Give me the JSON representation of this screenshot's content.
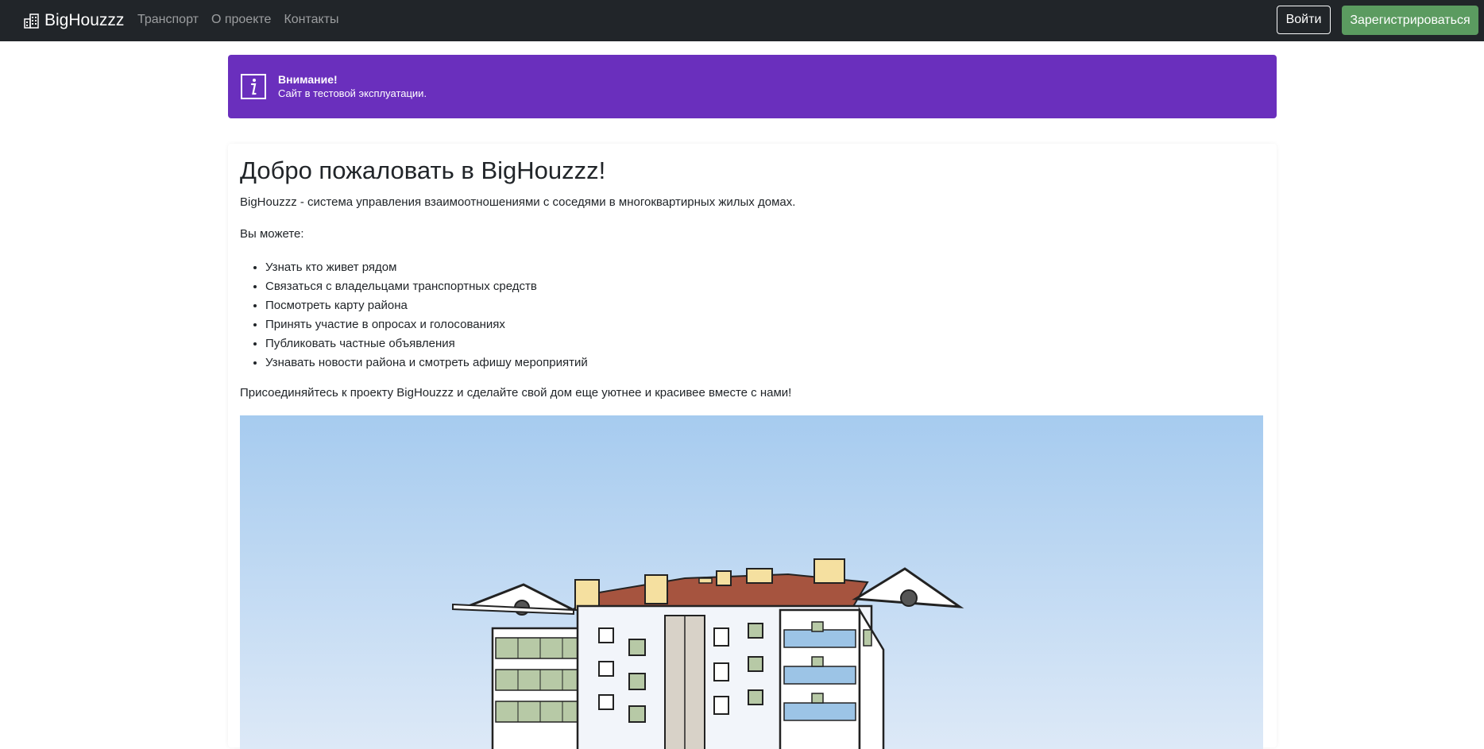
{
  "navbar": {
    "brand": "BigHouzzz",
    "links": [
      "Транспорт",
      "О проекте",
      "Контакты"
    ],
    "login_label": "Войти",
    "register_label": "Зарегистрироваться"
  },
  "alert": {
    "title": "Внимание!",
    "text": "Сайт в тестовой эксплуатации.",
    "icon": "info-icon",
    "color": "#6a2fbd"
  },
  "content": {
    "heading": "Добро пожаловать в BigHouzzz!",
    "intro": "BigHouzzz - система управления взаимоотношениями с соседями в многоквартирных жилых домах.",
    "can_label": "Вы можете:",
    "features": [
      "Узнать кто живет рядом",
      "Связаться с владельцами транспортных средств",
      "Посмотреть карту района",
      "Принять участие в опросах и голосованиях",
      "Публиковать частные объявления",
      "Узнавать новости района и смотреть афишу мероприятий"
    ],
    "join_text": "Присоединяйтесь к проекту BigHouzzz и сделайте свой дом еще уютнее и красивее вместе с нами!"
  },
  "colors": {
    "navbar_bg": "#212529",
    "register_button": "#5b9b60",
    "sky_top": "#a9cdf0"
  }
}
